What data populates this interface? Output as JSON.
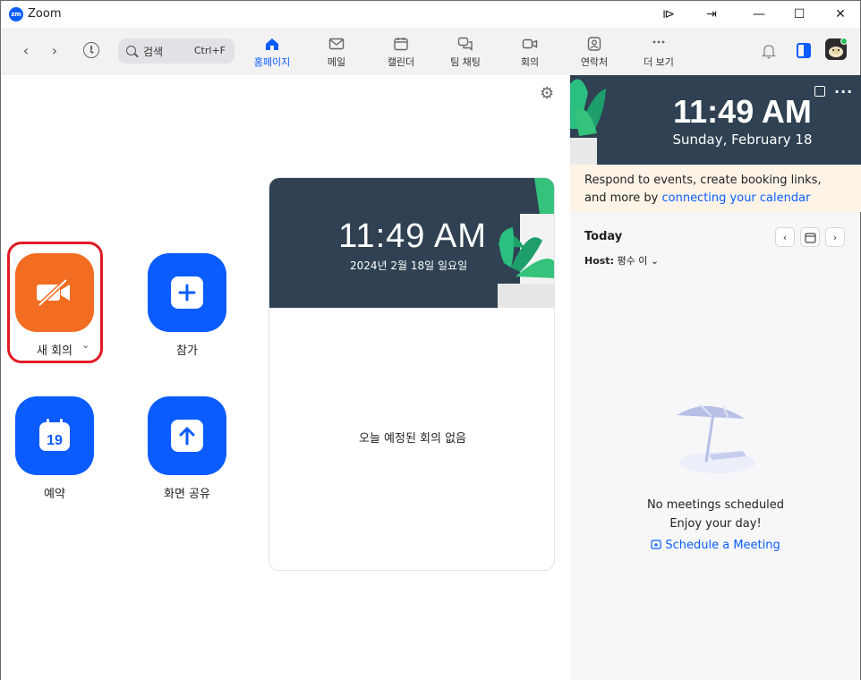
{
  "window": {
    "title": "Zoom",
    "logo_text": "zm",
    "controls": [
      "⧐",
      "⇥",
      "—",
      "☐",
      "✕"
    ]
  },
  "toolbar": {
    "search_label": "검색",
    "search_shortcut": "Ctrl+F",
    "tabs": [
      {
        "label": "홈페이지",
        "icon": "home-icon",
        "active": true
      },
      {
        "label": "메일",
        "icon": "mail-icon",
        "active": false
      },
      {
        "label": "캘린더",
        "icon": "calendar-icon",
        "active": false
      },
      {
        "label": "팀 채팅",
        "icon": "chat-icon",
        "active": false
      },
      {
        "label": "회의",
        "icon": "video-icon",
        "active": false
      },
      {
        "label": "연락처",
        "icon": "contacts-icon",
        "active": false
      },
      {
        "label": "더 보기",
        "icon": "more-icon",
        "active": false
      }
    ]
  },
  "home": {
    "actions": [
      {
        "label": "새 회의",
        "icon": "video-off-icon",
        "color": "#f26d21"
      },
      {
        "label": "참가",
        "icon": "plus-icon",
        "color": "#0b5cff"
      },
      {
        "label": "예약",
        "icon": "calendar-19-icon",
        "color": "#0b5cff",
        "icon_text": "19"
      },
      {
        "label": "화면 공유",
        "icon": "share-arrow-up-icon",
        "color": "#0b5cff"
      }
    ],
    "new_meeting_dropdown": "⌄",
    "card": {
      "time": "11:49 AM",
      "date": "2024년 2월 18일 일요일",
      "empty_message": "오늘 예정된 회의 없음"
    }
  },
  "sidebar": {
    "time": "11:49 AM",
    "date": "Sunday, February 18",
    "notice_text": "Respond to events, create booking links, and more by ",
    "notice_link": "connecting your calendar",
    "today_label": "Today",
    "host_label": "Host:",
    "host_value": "평수 이",
    "empty_title": "No meetings scheduled",
    "empty_subtitle": "Enjoy your day!",
    "schedule_link": "Schedule a Meeting"
  },
  "colors": {
    "accent": "#0b5cff",
    "orange": "#f26d21",
    "banner": "#2f4152",
    "highlight": "#e01b24"
  }
}
